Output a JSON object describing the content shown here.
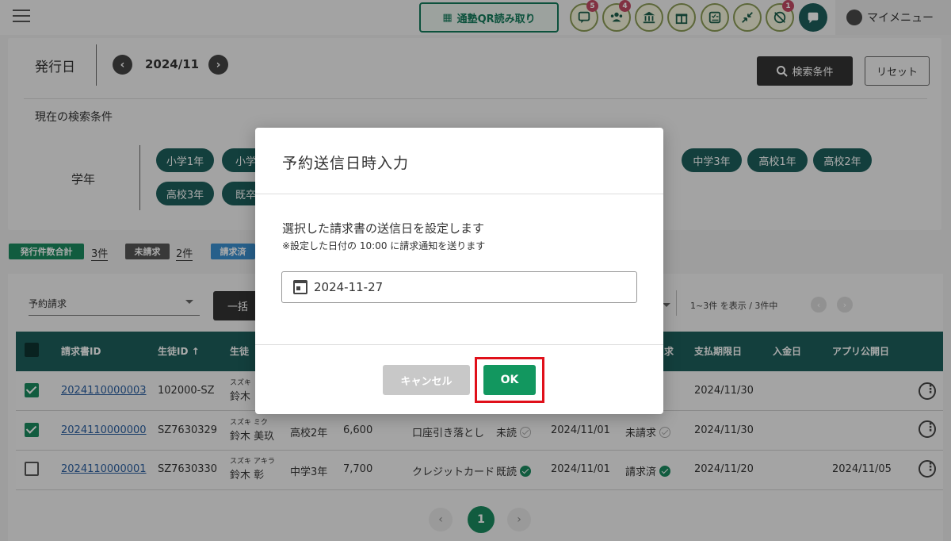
{
  "header": {
    "qr_button": "通塾QR読み取り",
    "badges": {
      "messages": "5",
      "group": "4",
      "alert": "1"
    },
    "my_menu": "マイメニュー"
  },
  "filter": {
    "issue_label": "発行日",
    "month": "2024/11",
    "search_button": "検索条件",
    "reset_button": "リセット",
    "current_conditions_title": "現在の検索条件",
    "grade_label": "学年",
    "grades": [
      "小学1年",
      "小学",
      "中学3年",
      "高校1年",
      "高校2年",
      "高校3年",
      "既卒"
    ]
  },
  "summary": {
    "issued_total_label": "発行件数合計",
    "issued_total_value": "3件",
    "unbilled_label": "未請求",
    "unbilled_value": "2件",
    "billed_label": "請求済"
  },
  "table_controls": {
    "select_value": "予約請求",
    "bulk_button": "一括",
    "count_text": "1~3件 を表示 / 3件中"
  },
  "table": {
    "headers": {
      "invoice_id": "請求書ID",
      "student_id": "生徒ID ↑",
      "student_name": "生徒",
      "due_date": "支払期限日",
      "paid_date": "入金日",
      "app_date": "アプリ公開日",
      "status_head": "求"
    },
    "rows": [
      {
        "invoice_id": "2024110000003",
        "student_id": "102000-SZ",
        "kana": "スズキ",
        "name": "鈴木",
        "grade": "",
        "amount": "",
        "method": "",
        "read": "",
        "issued": "",
        "bill_status": "",
        "due": "2024/11/30",
        "app_date": ""
      },
      {
        "invoice_id": "2024110000000",
        "student_id": "SZ7630329",
        "kana": "スズキ ミク",
        "name": "鈴木 美玖",
        "grade": "高校2年",
        "amount": "6,600",
        "method": "口座引き落とし",
        "read": "未読",
        "issued": "2024/11/01",
        "bill_status": "未請求",
        "due": "2024/11/30",
        "app_date": ""
      },
      {
        "invoice_id": "2024110000001",
        "student_id": "SZ7630330",
        "kana": "スズキ アキラ",
        "name": "鈴木 彰",
        "grade": "中学3年",
        "amount": "7,700",
        "method": "クレジットカード",
        "read": "既読",
        "issued": "2024/11/01",
        "bill_status": "請求済",
        "due": "2024/11/20",
        "app_date": "2024/11/05"
      }
    ]
  },
  "pager": {
    "current": "1",
    "prev": "‹",
    "next": "›"
  },
  "modal": {
    "title": "予約送信日時入力",
    "description": "選択した請求書の送信日を設定します",
    "note": "※設定した日付の 10:00 に請求通知を送ります",
    "date_value": "2024-11-27",
    "cancel_button": "キャンセル",
    "ok_button": "OK"
  },
  "colors": {
    "primary": "#1d5e5b",
    "ok_green": "#12975f",
    "highlight_red": "#e0101a",
    "link_blue": "#2a5fa0"
  }
}
